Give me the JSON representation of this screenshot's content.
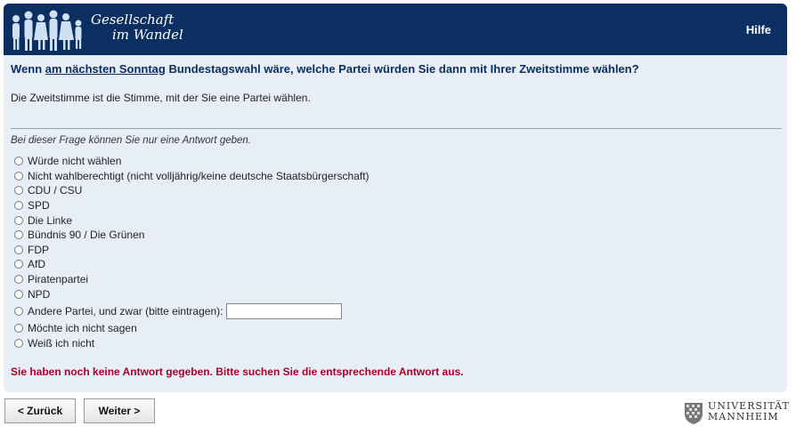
{
  "header": {
    "logo_line1": "Gesellschaft",
    "logo_line2": "im Wandel",
    "help_label": "Hilfe",
    "bg_color": "#0a2f60"
  },
  "question": {
    "prefix": "Wenn ",
    "underlined": "am nächsten Sonntag",
    "suffix": " Bundestagswahl wäre, welche Partei würden Sie dann mit Ihrer Zweitstimme wählen?",
    "description": "Die Zweitstimme ist die Stimme, mit der Sie eine Partei wählen."
  },
  "hint": "Bei dieser Frage können Sie nur eine Antwort geben.",
  "options": [
    "Würde nicht wählen",
    "Nicht wahlberechtigt (nicht volljährig/keine deutsche Staatsbürgerschaft)",
    "CDU / CSU",
    "SPD",
    "Die Linke",
    "Bündnis 90 / Die Grünen",
    "FDP",
    "AfD",
    "Piratenpartei",
    "NPD",
    "Andere Partei, und zwar (bitte eintragen):",
    "Möchte ich nicht sagen",
    "Weiß ich nicht"
  ],
  "other_input_value": "",
  "error_message": "Sie haben noch keine Antwort gegeben. Bitte suchen Sie die entsprechende Antwort aus.",
  "nav": {
    "back_label": "< Zurück",
    "next_label": "Weiter >"
  },
  "university": {
    "line1": "UNIVERSITÄT",
    "line2": "MANNHEIM"
  }
}
